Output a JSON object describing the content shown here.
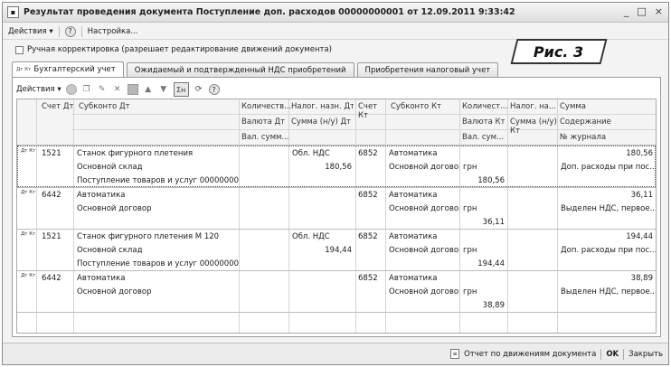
{
  "window": {
    "title": "Результат проведения документа Поступление доп. расходов 00000000001 от 12.09.2011 9:33:42",
    "controls": [
      "_",
      "□",
      "×"
    ]
  },
  "menubar": {
    "actions_label": "Действия",
    "help_glyph": "?",
    "settings_label": "Настройка..."
  },
  "manual_correction_label": "Ручная корректировка (разрешает редактирование движений документа)",
  "badge_label": "Рис. 3",
  "tabs": [
    {
      "label": "Бухгалтерский учет"
    },
    {
      "label": "Ожидаемый и подтвержденный НДС приобретений"
    },
    {
      "label": "Приобретения налоговый учет"
    }
  ],
  "tab_icon_text": "Дт Кт",
  "toolbar": {
    "actions_label": "Действия",
    "sum_glyph": "Σн",
    "help_glyph": "?"
  },
  "grid": {
    "headers": {
      "schet_dt": "Счет Дт",
      "subkonto_dt": "Субконто Дт",
      "kol_dt": "Количеств...",
      "valyuta_dt": "Валюта Дт",
      "val_summ_dt": "Вал. сумм...",
      "nalog_nazn_dt": "Налог. назн. Дт",
      "summa_nu_dt": "Сумма (н/у) Дт",
      "schet_kt_1": "Счет",
      "schet_kt_2": "Кт",
      "subkonto_kt": "Субконто Кт",
      "kol_kt": "Количест...",
      "valyuta_kt": "Валюта Кт",
      "val_summ_kt": "Вал. сум...",
      "nalog_kt": "Налог. на...",
      "summa_nu_kt_1": "Сумма (н/у)",
      "summa_nu_kt_2": "Кт",
      "summa": "Сумма",
      "soderzhanie": "Содержание",
      "n_zhurnala": "№ журнала"
    },
    "rows": [
      {
        "schet_dt": "1521",
        "subkonto_dt": [
          "Станок фигурного плетения",
          "Основной склад",
          "Поступление товаров и услуг 0000000000..."
        ],
        "nalog_nazn_dt": "Обл. НДС",
        "kol_dt": "180,56",
        "schet_kt": "6852",
        "subkonto_kt": [
          "Автоматика",
          "Основной договор"
        ],
        "valyuta_kt": "грн",
        "val_summ_kt": "180,56",
        "summa": "180,56",
        "soderzhanie": "Доп. расходы при пос..."
      },
      {
        "schet_dt": "6442",
        "subkonto_dt": [
          "Автоматика",
          "Основной договор",
          ""
        ],
        "nalog_nazn_dt": "",
        "kol_dt": "",
        "schet_kt": "6852",
        "subkonto_kt": [
          "Автоматика",
          "Основной договор"
        ],
        "valyuta_kt": "грн",
        "val_summ_kt": "36,11",
        "summa": "36,11",
        "soderzhanie": "Выделен НДС, первое..."
      },
      {
        "schet_dt": "1521",
        "subkonto_dt": [
          "Станок фигурного плетения М 120",
          "Основной склад",
          "Поступление товаров и услуг 0000000000..."
        ],
        "nalog_nazn_dt": "Обл. НДС",
        "kol_dt": "194,44",
        "schet_kt": "6852",
        "subkonto_kt": [
          "Автоматика",
          "Основной договор"
        ],
        "valyuta_kt": "грн",
        "val_summ_kt": "194,44",
        "summa": "194,44",
        "soderzhanie": "Доп. расходы при пос..."
      },
      {
        "schet_dt": "6442",
        "subkonto_dt": [
          "Автоматика",
          "Основной договор",
          ""
        ],
        "nalog_nazn_dt": "",
        "kol_dt": "",
        "schet_kt": "6852",
        "subkonto_kt": [
          "Автоматика",
          "Основной договор"
        ],
        "valyuta_kt": "грн",
        "val_summ_kt": "38,89",
        "summa": "38,89",
        "soderzhanie": "Выделен НДС, первое..."
      }
    ]
  },
  "statusbar": {
    "report_label": "Отчет по движениям документа",
    "ok_label": "OK",
    "close_label": "Закрыть"
  }
}
